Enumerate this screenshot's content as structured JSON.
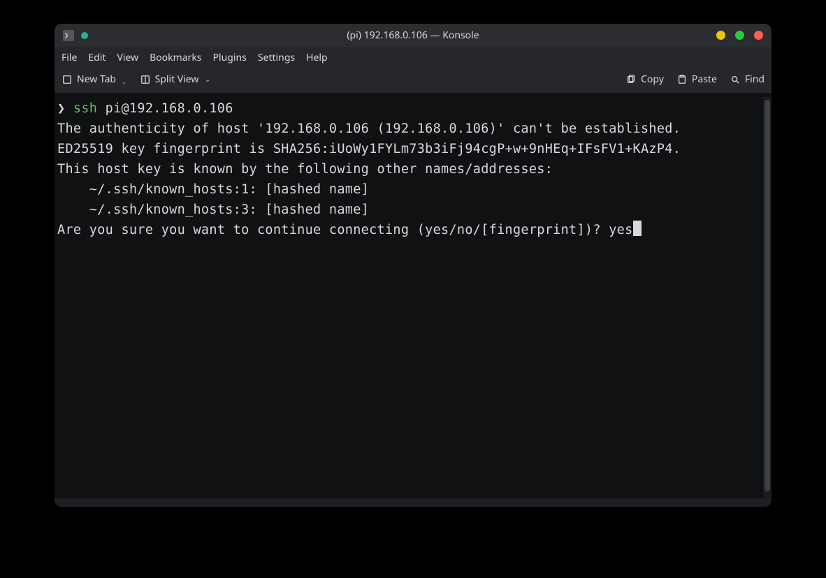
{
  "window": {
    "title": "(pi) 192.168.0.106 — Konsole"
  },
  "menubar": {
    "items": [
      "File",
      "Edit",
      "View",
      "Bookmarks",
      "Plugins",
      "Settings",
      "Help"
    ]
  },
  "toolbar": {
    "new_tab": "New Tab",
    "split_view": "Split View",
    "copy": "Copy",
    "paste": "Paste",
    "find": "Find"
  },
  "terminal": {
    "prompt_symbol": "❯",
    "command_name": "ssh",
    "command_args": " pi@192.168.0.106",
    "out_line1": "The authenticity of host '192.168.0.106 (192.168.0.106)' can't be established.",
    "out_line2": "ED25519 key fingerprint is SHA256:iUoWy1FYLm73b3iFj94cgP+w+9nHEq+IFsFV1+KAzP4.",
    "out_line3": "This host key is known by the following other names/addresses:",
    "out_line4": "    ~/.ssh/known_hosts:1: [hashed name]",
    "out_line5": "    ~/.ssh/known_hosts:3: [hashed name]",
    "prompt_question": "Are you sure you want to continue connecting (yes/no/[fingerprint])? ",
    "user_response": "yes"
  }
}
